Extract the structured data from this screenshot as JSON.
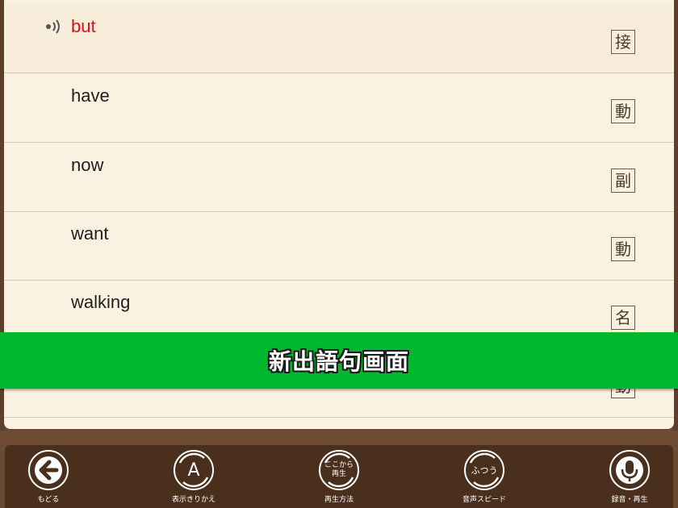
{
  "words": [
    {
      "text": "but",
      "pos": "接",
      "active": true
    },
    {
      "text": "have",
      "pos": "動"
    },
    {
      "text": "now",
      "pos": "副"
    },
    {
      "text": "want",
      "pos": "動"
    },
    {
      "text": "walking",
      "pos": "名"
    },
    {
      "text": "",
      "pos": "動"
    }
  ],
  "banner": {
    "text": "新出語句画面"
  },
  "toolbar": {
    "back": {
      "label": "もどる"
    },
    "display": {
      "label": "表示きりかえ",
      "glyph": "A"
    },
    "play_mode": {
      "label": "再生方法",
      "line1": "ここから",
      "line2": "再生"
    },
    "speed": {
      "label": "音声スピード",
      "value": "ふつう"
    },
    "record": {
      "label": "録音・再生"
    }
  },
  "colors": {
    "active_word": "#e01010",
    "banner": "#00b82e",
    "toolbar": "#4a2f1d",
    "panel": "#fbf1e0"
  },
  "icons": [
    "speaker-icon",
    "back-arrow-icon",
    "letter-a-icon",
    "refresh-arrows-icon",
    "microphone-icon"
  ]
}
